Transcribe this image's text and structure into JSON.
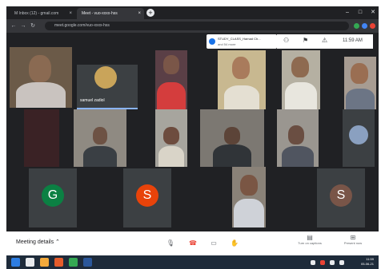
{
  "browser": {
    "tabs": [
      {
        "label": "M  Inbox (12) - gmail.com",
        "active": false
      },
      {
        "label": "Meet - vuo-xxxx-hss",
        "active": true
      }
    ],
    "address": "meet.google.com/vuo-xxxx-hss",
    "new_tab_icon": "plus-icon"
  },
  "meet": {
    "presenting": {
      "title": "STUDY_CLASS_Hamad Ch...",
      "subtitle": "and 54 more"
    },
    "time": "11:59 AM",
    "pinned_label": "samuel zadiol",
    "avatars": [
      {
        "letter": "G",
        "color": "#0b8043"
      },
      {
        "letter": "S",
        "color": "#e8430a"
      },
      {
        "letter": "S",
        "color": "#795548"
      }
    ]
  },
  "controls": {
    "meeting_details": "Meeting details",
    "right_buttons": [
      {
        "icon": "captions-icon",
        "label": "Turn on captions"
      },
      {
        "icon": "present-icon",
        "label": "Present now"
      }
    ]
  },
  "taskbar": {
    "time": "11:59",
    "date": "05-06-21"
  }
}
